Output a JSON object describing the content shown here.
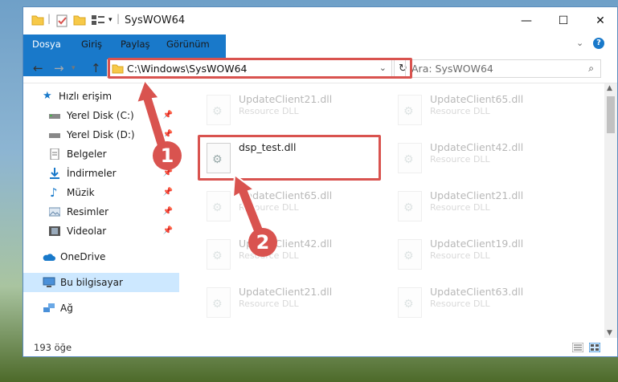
{
  "window": {
    "title": "SysWOW64",
    "controls": {
      "minimize": "—",
      "maximize": "☐",
      "close": "✕"
    }
  },
  "ribbon": {
    "tabs": [
      "Dosya",
      "Giriş",
      "Paylaş",
      "Görünüm"
    ],
    "help": "?"
  },
  "address": {
    "path": "C:\\Windows\\SysWOW64",
    "search_placeholder": "Ara: SysWOW64"
  },
  "sidebar": {
    "items": [
      {
        "label": "Hızlı erişim",
        "icon": "star-icon",
        "pinned": false
      },
      {
        "label": "Yerel Disk (C:)",
        "icon": "drive-icon",
        "pinned": true
      },
      {
        "label": "Yerel Disk (D:)",
        "icon": "drive-icon",
        "pinned": true
      },
      {
        "label": "Belgeler",
        "icon": "document-icon",
        "pinned": true
      },
      {
        "label": "İndirmeler",
        "icon": "download-icon",
        "pinned": true
      },
      {
        "label": "Müzik",
        "icon": "music-icon",
        "pinned": true
      },
      {
        "label": "Resimler",
        "icon": "pictures-icon",
        "pinned": true
      },
      {
        "label": "Videolar",
        "icon": "video-icon",
        "pinned": true
      },
      {
        "label": "OneDrive",
        "icon": "cloud-icon",
        "pinned": false
      },
      {
        "label": "Bu bilgisayar",
        "icon": "computer-icon",
        "pinned": false,
        "selected": true
      },
      {
        "label": "Ağ",
        "icon": "network-icon",
        "pinned": false
      }
    ]
  },
  "files": {
    "left": [
      {
        "name": "UpdateClient21.dll",
        "type": "Resource DLL",
        "faded": true
      },
      {
        "name": "dsp_test.dll",
        "type": "",
        "faded": false
      },
      {
        "name": "UpdateClient65.dll",
        "type": "Resource DLL",
        "faded": true
      },
      {
        "name": "UpdateClient42.dll",
        "type": "Resource DLL",
        "faded": true
      },
      {
        "name": "UpdateClient21.dll",
        "type": "Resource DLL",
        "faded": true
      }
    ],
    "right": [
      {
        "name": "UpdateClient65.dll",
        "type": "Resource DLL",
        "faded": true
      },
      {
        "name": "UpdateClient42.dll",
        "type": "Resource DLL",
        "faded": true
      },
      {
        "name": "UpdateClient21.dll",
        "type": "Resource DLL",
        "faded": true
      },
      {
        "name": "UpdateClient19.dll",
        "type": "Resource DLL",
        "faded": true
      },
      {
        "name": "UpdateClient63.dll",
        "type": "Resource DLL",
        "faded": true
      }
    ]
  },
  "status": {
    "count": "193 öğe"
  },
  "annotations": {
    "step1": "1",
    "step2": "2",
    "color": "#d9534f"
  }
}
